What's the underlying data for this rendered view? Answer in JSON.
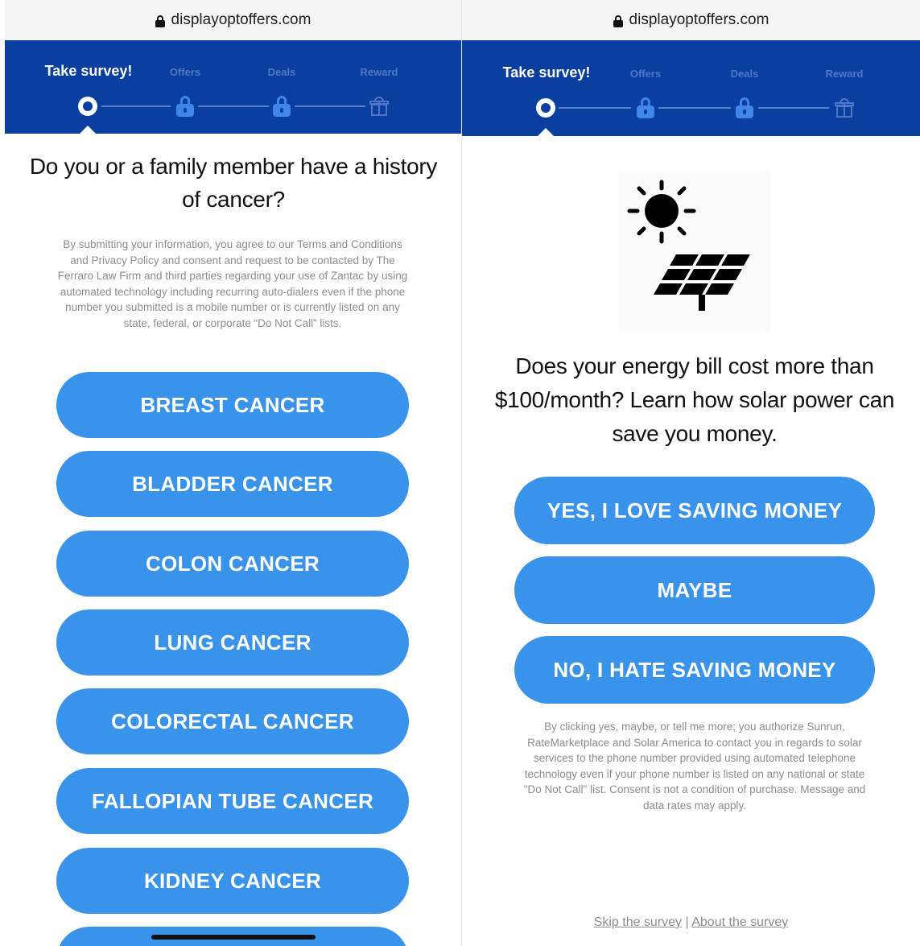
{
  "left": {
    "url": "displayoptoffers.com",
    "steps": [
      "Take survey!",
      "Offers",
      "Deals",
      "Reward"
    ],
    "question": "Do you or a family member have a history of cancer?",
    "disclaimer": "By submitting your information, you agree to our Terms and Conditions and Privacy Policy and consent and request to be contacted by The Ferraro Law Firm and third parties regarding your use of Zantac by using automated technology including recurring auto-dialers even if the phone number you submitted is a mobile number or is currently listed on any state, federal, or corporate “Do Not Call” lists.",
    "answers": [
      "BREAST CANCER",
      "BLADDER CANCER",
      "COLON CANCER",
      "LUNG CANCER",
      "COLORECTAL CANCER",
      "FALLOPIAN TUBE CANCER",
      "KIDNEY CANCER"
    ]
  },
  "right": {
    "url": "displayoptoffers.com",
    "steps": [
      "Take survey!",
      "Offers",
      "Deals",
      "Reward"
    ],
    "image_icon": "sun-and-solar-panel-icon",
    "question": "Does your energy bill cost more than $100/month? Learn how solar power can save you money.",
    "answers": [
      "YES, I LOVE SAVING MONEY",
      "MAYBE",
      "NO, I HATE SAVING MONEY"
    ],
    "disclaimer": "By clicking yes, maybe, or tell me more; you authorize Sunrun, RateMarketplace and Solar America to contact you in regards to solar services to the phone number provided using automated telephone technology even if your phone number is listed on any national or state \"Do Not Call\" list. Consent is not a condition of purchase. Message and data rates may apply.",
    "footer": {
      "skip": "Skip the survey",
      "separator": "|",
      "about": "About the survey"
    }
  },
  "colors": {
    "header_blue": "#0a3fa0",
    "button_blue": "#3a93ea",
    "lock_blue": "#3e86e8"
  }
}
